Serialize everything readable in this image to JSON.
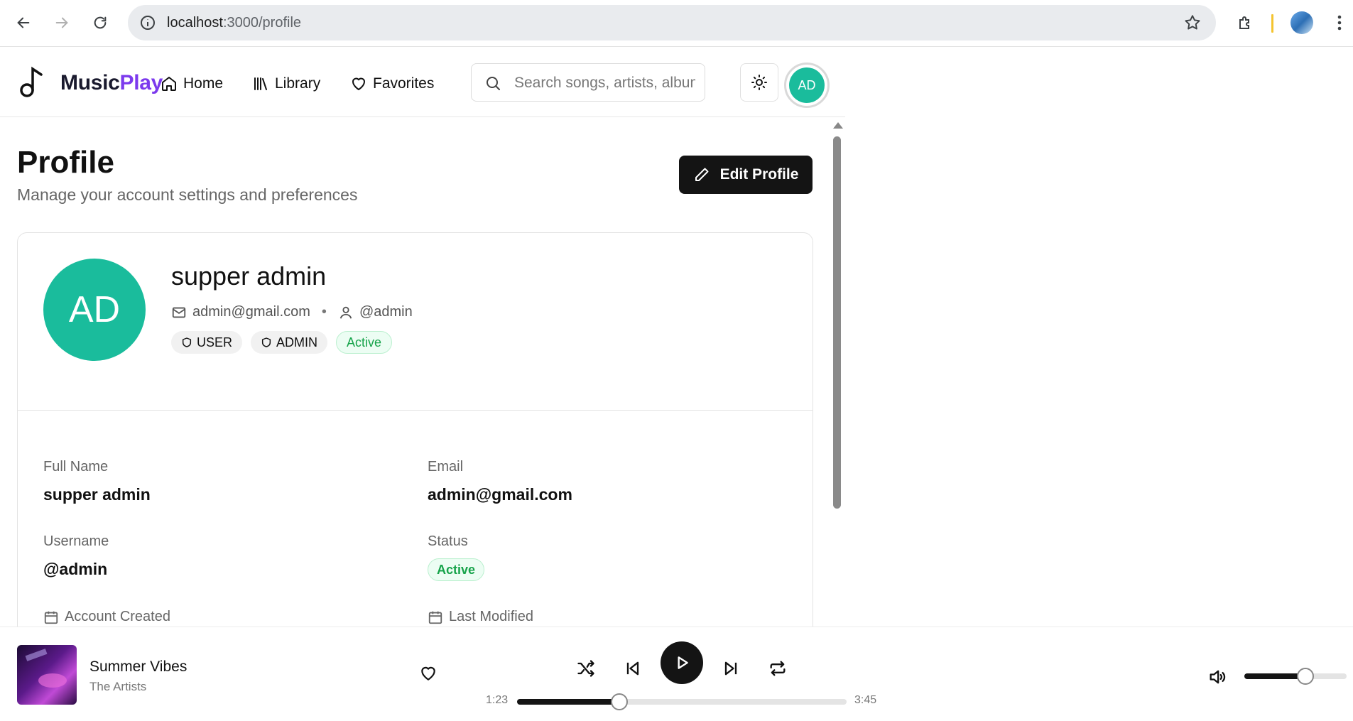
{
  "browser": {
    "url_host": "localhost",
    "url_path": ":3000/profile"
  },
  "header": {
    "logo_main": "Music",
    "logo_accent": "Play",
    "nav": [
      {
        "label": "Home",
        "icon": "home-icon"
      },
      {
        "label": "Library",
        "icon": "library-icon"
      },
      {
        "label": "Favorites",
        "icon": "heart-icon"
      }
    ],
    "search_placeholder": "Search songs, artists, albums...",
    "avatar_initials": "AD"
  },
  "page": {
    "title": "Profile",
    "subtitle": "Manage your account settings and preferences",
    "edit_button": "Edit Profile"
  },
  "profile": {
    "avatar_initials": "AD",
    "name": "supper admin",
    "email": "admin@gmail.com",
    "username": "@admin",
    "roles": [
      "USER",
      "ADMIN"
    ],
    "status": "Active"
  },
  "details": {
    "full_name_label": "Full Name",
    "full_name_value": "supper admin",
    "email_label": "Email",
    "email_value": "admin@gmail.com",
    "username_label": "Username",
    "username_value": "@admin",
    "status_label": "Status",
    "status_value": "Active",
    "created_label": "Account Created",
    "modified_label": "Last Modified"
  },
  "player": {
    "track_title": "Summer Vibes",
    "track_artist": "The Artists",
    "current_time": "1:23",
    "total_time": "3:45",
    "progress_fraction": 0.31,
    "volume_fraction": 0.6
  },
  "colors": {
    "accent": "#7c3aed",
    "avatar": "#1abc9c",
    "status_green": "#16a34a",
    "dark_button": "#141414"
  }
}
